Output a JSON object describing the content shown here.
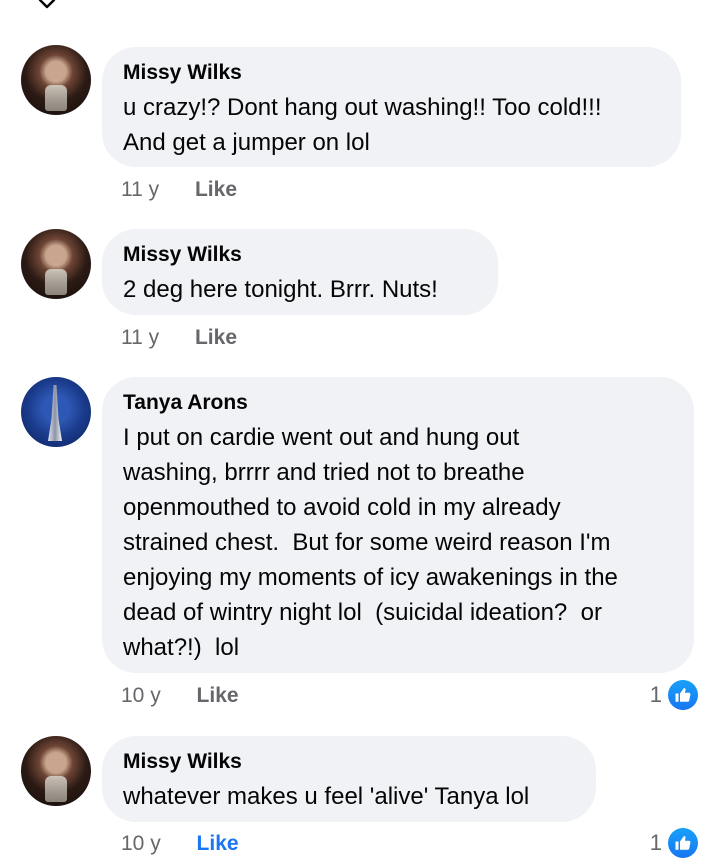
{
  "comments": [
    {
      "author": "Missy Wilks",
      "text": "u crazy!? Dont hang out washing!! Too cold!!!\nAnd get a jumper on lol",
      "time": "11 y",
      "like_label": "Like",
      "like_active": false,
      "reactions": null
    },
    {
      "author": "Missy Wilks",
      "text": "2 deg here tonight. Brrr. Nuts!",
      "time": "11 y",
      "like_label": "Like",
      "like_active": false,
      "reactions": null
    },
    {
      "author": "Tanya Arons",
      "text": "I put on cardie went out and hung out\nwashing, brrrr and tried not to breathe\nopenmouthed to avoid cold in my already\nstrained chest.  But for some weird reason I'm\nenjoying my moments of icy awakenings in the\ndead of wintry night lol  (suicidal ideation?  or\nwhat?!)  lol",
      "time": "10 y",
      "like_label": "Like",
      "like_active": false,
      "reactions": "1"
    },
    {
      "author": "Missy Wilks",
      "text": "whatever makes u feel 'alive' Tanya lol",
      "time": "10 y",
      "like_label": "Like",
      "like_active": true,
      "reactions": "1"
    }
  ],
  "colors": {
    "bubble": "#f0f2f5",
    "meta_text": "#65676b",
    "like_active": "#1877f2"
  },
  "icons": {
    "collapse": "chevron-down-icon",
    "reaction": "thumbs-up-icon"
  }
}
